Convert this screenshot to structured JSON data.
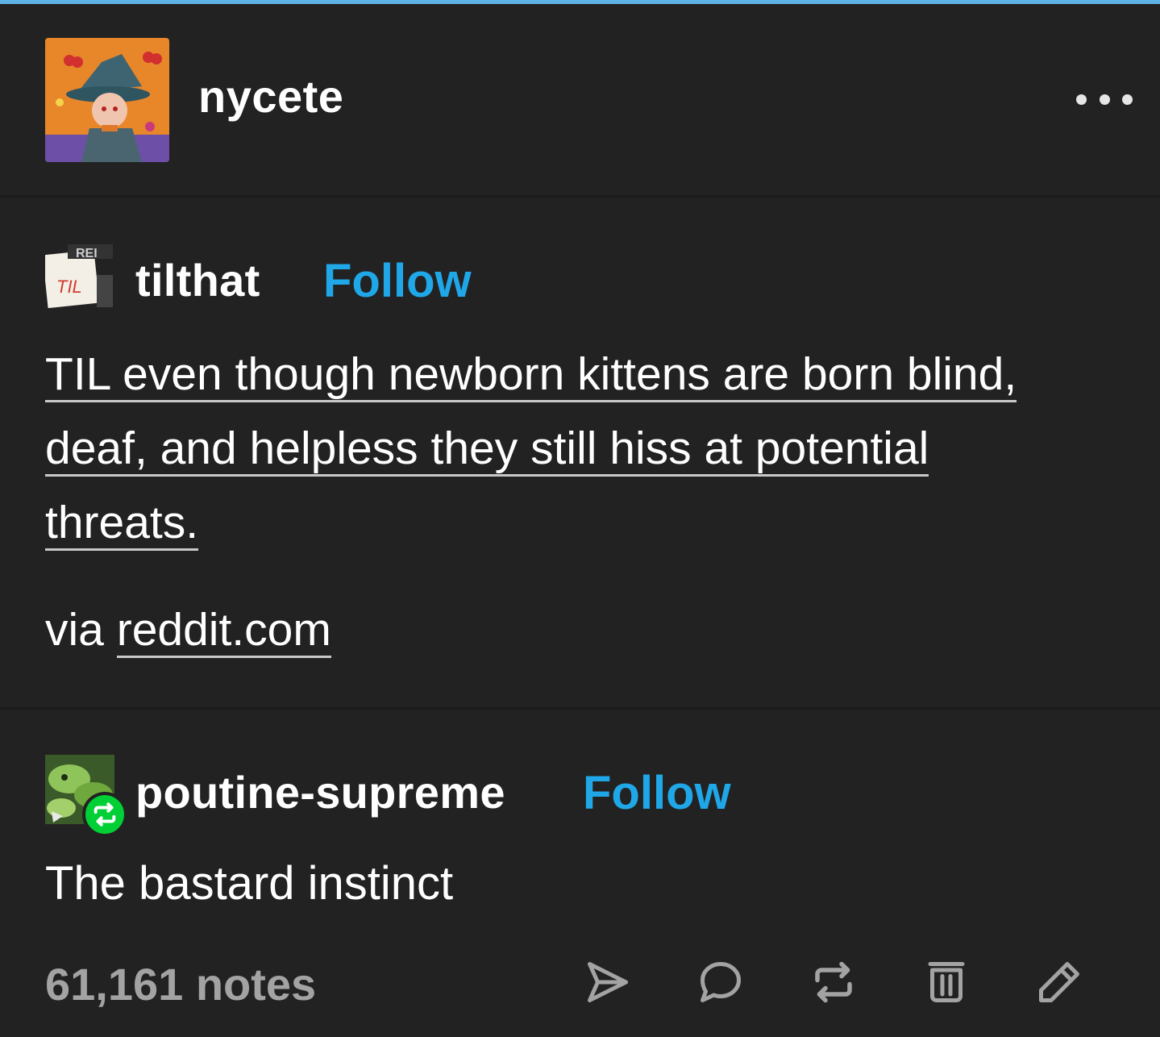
{
  "header": {
    "username": "nycete",
    "avatar_icon": "witch-avatar-icon",
    "more_icon": "more-dots-icon"
  },
  "reblogs": [
    {
      "username": "tilthat",
      "follow_label": "Follow",
      "avatar_icon": "til-avatar-icon",
      "link_title_lines": [
        "TIL even though newborn kittens are born blind,",
        "deaf, and helpless they still hiss at potential",
        "threats."
      ],
      "via_prefix": "via",
      "via_link": "reddit.com"
    },
    {
      "username": "poutine-supreme",
      "follow_label": "Follow",
      "avatar_icon": "leaf-avatar-icon",
      "reblog_badge_icon": "reblog-badge-icon",
      "comment": "The bastard instinct"
    }
  ],
  "footer": {
    "notes": "61,161 notes",
    "actions": [
      "share-icon",
      "reply-icon",
      "reblog-icon",
      "delete-icon",
      "edit-icon"
    ]
  },
  "colors": {
    "background": "#222222",
    "accent_blue": "#1fa7e8",
    "text": "#ffffff",
    "muted": "#a3a3a3",
    "reblog_green": "#00cf35",
    "top_bar": "#5fb3e6"
  }
}
